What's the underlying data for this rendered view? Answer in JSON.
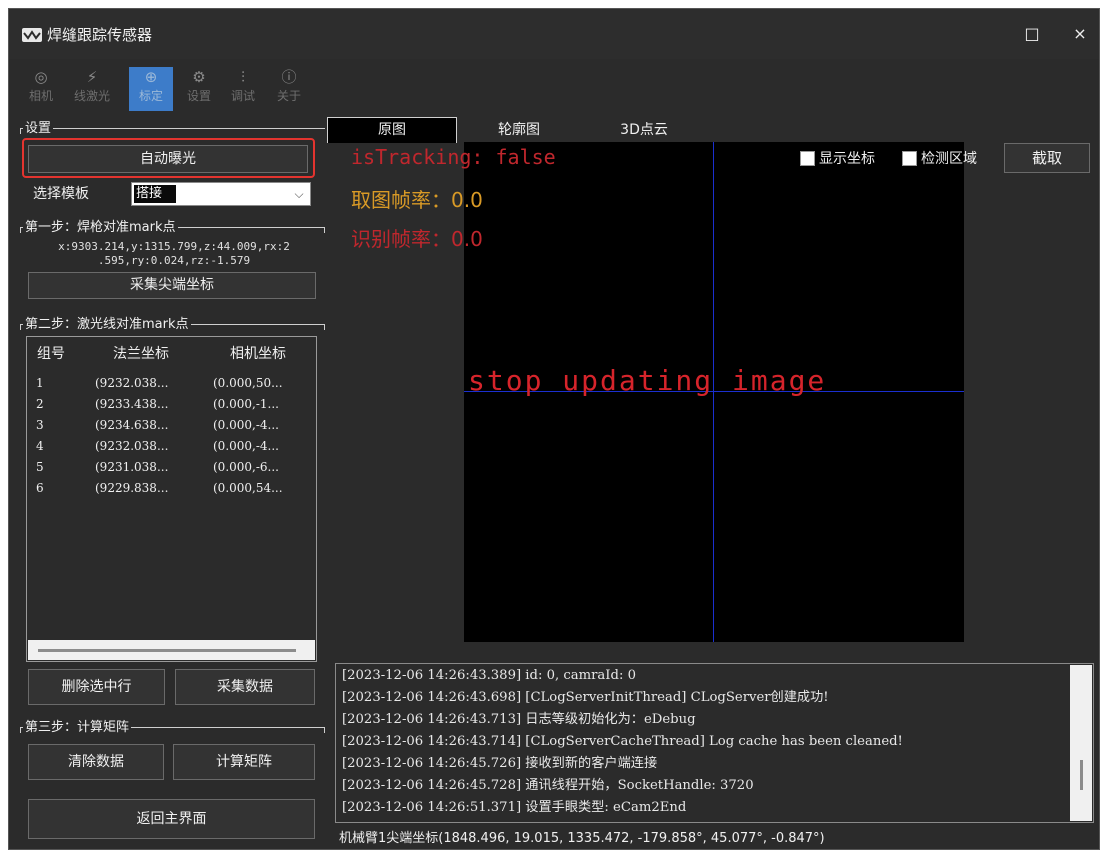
{
  "window": {
    "title": "焊缝跟踪传感器",
    "maximize_icon": "□",
    "close_icon": "×"
  },
  "toolbar": {
    "items": [
      {
        "label": "相机",
        "icon": "camera-icon",
        "glyph": "◎"
      },
      {
        "label": "线激光",
        "icon": "laser-icon",
        "glyph": "⚡"
      },
      {
        "label": "标定",
        "icon": "calibrate-icon",
        "glyph": "⊕"
      },
      {
        "label": "设置",
        "icon": "gear-icon",
        "glyph": "⚙"
      },
      {
        "label": "调试",
        "icon": "sliders-icon",
        "glyph": "⫶"
      },
      {
        "label": "关于",
        "icon": "info-icon",
        "glyph": "ⓘ"
      }
    ],
    "active_index": 2
  },
  "left": {
    "group_settings": "设置",
    "auto_exposure": "自动曝光",
    "template_label": "选择模板",
    "template_value": "搭接",
    "step1": {
      "title": "第一步：焊枪对准mark点",
      "coords_line1": "x:9303.214,y:1315.799,z:44.009,rx:2",
      "coords_line2": ".595,ry:0.024,rz:-1.579",
      "collect_tip": "采集尖端坐标"
    },
    "step2": {
      "title": "第二步：激光线对准mark点",
      "headers": [
        "组号",
        "法兰坐标",
        "相机坐标"
      ],
      "rows": [
        [
          "1",
          "(9232.038...",
          "(0.000,50..."
        ],
        [
          "2",
          "(9233.438...",
          "(0.000,-1..."
        ],
        [
          "3",
          "(9234.638...",
          "(0.000,-4..."
        ],
        [
          "4",
          "(9232.038...",
          "(0.000,-4..."
        ],
        [
          "5",
          "(9231.038...",
          "(0.000,-6..."
        ],
        [
          "6",
          "(9229.838...",
          "(0.000,54..."
        ]
      ],
      "delete_selected": "删除选中行",
      "collect_data": "采集数据"
    },
    "step3": {
      "title": "第三步：计算矩阵",
      "clear_data": "清除数据",
      "compute_matrix": "计算矩阵"
    },
    "back_main": "返回主界面"
  },
  "tabs": [
    "原图",
    "轮廓图",
    "3D点云"
  ],
  "active_tab": 0,
  "view": {
    "tracking": "isTracking: false",
    "capture_fps": "取图帧率：0.0",
    "recog_fps": "识别帧率：0.0",
    "stop_msg": "stop updating image",
    "show_coords": "显示坐标",
    "detect_region": "检测区域",
    "screenshot": "截取"
  },
  "log": [
    "[2023-12-06 14:26:43.389] id: 0, camraId: 0",
    "[2023-12-06 14:26:43.698] [CLogServerInitThread] CLogServer创建成功!",
    "[2023-12-06 14:26:43.713] 日志等级初始化为：eDebug",
    "[2023-12-06 14:26:43.714] [CLogServerCacheThread] Log cache has been cleaned!",
    "[2023-12-06 14:26:45.726] 接收到新的客户端连接",
    "[2023-12-06 14:26:45.728] 通讯线程开始，SocketHandle: 3720",
    "[2023-12-06 14:26:51.371] 设置手眼类型: eCam2End"
  ],
  "status": "机械臂1尖端坐标(1848.496, 19.015, 1335.472, -179.858°, 45.077°, -0.847°)",
  "colors": {
    "accent": "#3d7cc9",
    "highlight": "#e3342f",
    "tracking": "#c0272d",
    "fps": "#d99a26",
    "crosshair": "#1a2fd0"
  }
}
